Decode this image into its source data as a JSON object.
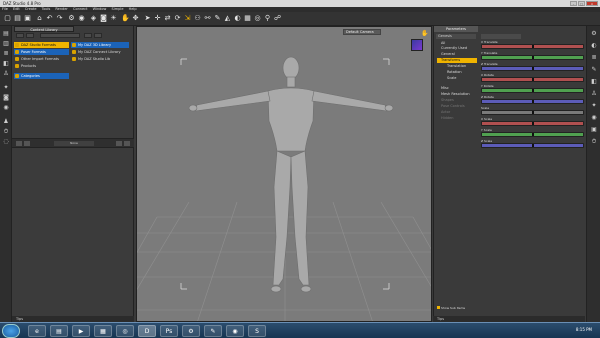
{
  "window": {
    "title": "DAZ Studio 4.8 Pro"
  },
  "menu": [
    "File",
    "Edit",
    "Create",
    "Tools",
    "Render",
    "Connect",
    "Window",
    "Simple",
    "Help"
  ],
  "toolbar": {
    "icons": [
      "new-icon",
      "open-icon",
      "save-icon",
      "home-icon",
      "undo-icon",
      "redo-icon",
      "render-settings-icon",
      "render-icon",
      "cube-icon",
      "camera-icon",
      "light-icon",
      "hand-icon",
      "move-icon",
      "pointer-icon",
      "universal-tool-icon",
      "translate-icon",
      "rotate-icon",
      "scale-icon",
      "node-icon",
      "joint-icon",
      "weight-icon",
      "geometry-icon",
      "surface-icon",
      "region-icon",
      "spot-render-icon",
      "pin-icon",
      "morph-icon"
    ]
  },
  "content_library": {
    "tab": "Content Library",
    "left_items": [
      {
        "label": "DAZ Studio Formats",
        "state": "selected"
      },
      {
        "label": "Poser Formats",
        "state": "blue"
      },
      {
        "label": "Other Import Formats",
        "state": "plain"
      },
      {
        "label": "Products",
        "state": "plain"
      },
      {
        "label": "Categories",
        "state": "blue"
      }
    ],
    "right_items": [
      {
        "label": "My DAZ 3D Library",
        "state": "blue"
      },
      {
        "label": "My DAZ Connect Library",
        "state": "plain"
      },
      {
        "label": "My DAZ Studio Lib",
        "state": "plain"
      }
    ],
    "bottom_label": "None",
    "status": "Tips"
  },
  "viewport": {
    "camera": "Default Camera"
  },
  "parameters": {
    "tab": "Parameters",
    "node": "Genesis",
    "tree": [
      {
        "label": "All",
        "state": "plain"
      },
      {
        "label": "Currently Used",
        "state": "plain"
      },
      {
        "label": "General",
        "state": "plain"
      },
      {
        "label": "Transforms",
        "state": "selected"
      },
      {
        "label": "Translation",
        "state": "plain"
      },
      {
        "label": "Rotation",
        "state": "plain"
      },
      {
        "label": "Scale",
        "state": "plain"
      },
      {
        "label": "Misc",
        "state": "plain"
      },
      {
        "label": "Mesh Resolution",
        "state": "plain"
      },
      {
        "label": "Shapes",
        "state": "dim"
      },
      {
        "label": "Pose Controls",
        "state": "dim"
      },
      {
        "label": "Actor",
        "state": "dim"
      },
      {
        "label": "Hidden",
        "state": "dim"
      }
    ],
    "sliders": [
      {
        "label": "X Translate",
        "color": "#b05050",
        "value": 0.5
      },
      {
        "label": "Y Translate",
        "color": "#50a050",
        "value": 0.5
      },
      {
        "label": "Z Translate",
        "color": "#5c5cb8",
        "value": 0.5
      },
      {
        "label": "X Rotate",
        "color": "#b05050",
        "value": 0.5
      },
      {
        "label": "Y Rotate",
        "color": "#50a050",
        "value": 0.5
      },
      {
        "label": "Z Rotate",
        "color": "#5c5cb8",
        "value": 0.5
      },
      {
        "label": "Scale",
        "color": "#7a7a7a",
        "value": 0.5
      },
      {
        "label": "X Scale",
        "color": "#b05050",
        "value": 0.5
      },
      {
        "label": "Y Scale",
        "color": "#50a050",
        "value": 0.5
      },
      {
        "label": "Z Scale",
        "color": "#5c5cb8",
        "value": 0.5
      }
    ],
    "show_sub_items": "Show Sub Items",
    "status": "Tips"
  },
  "taskbar": {
    "clock": "8:15 PM",
    "apps": [
      "ie-icon",
      "explorer-icon",
      "media-icon",
      "folder-icon",
      "firefox-icon",
      "daz-icon",
      "photoshop-icon",
      "settings-icon",
      "notepad-icon",
      "chrome-icon",
      "skype-icon"
    ]
  }
}
